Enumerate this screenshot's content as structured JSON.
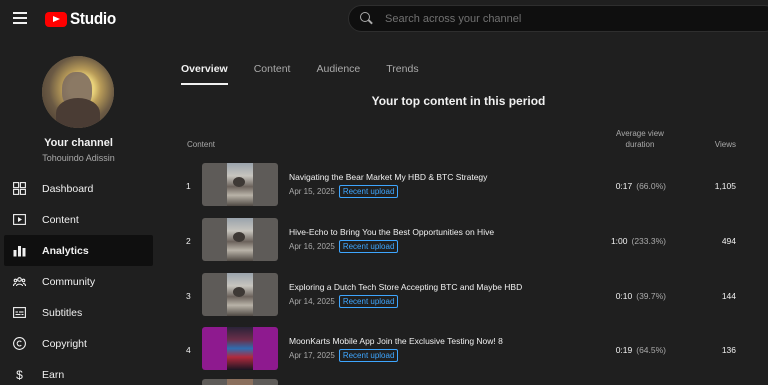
{
  "app": {
    "logo_text": "Studio"
  },
  "search": {
    "placeholder": "Search across your channel",
    "value": ""
  },
  "channel": {
    "title": "Your channel",
    "handle": "Tohouindo Adissin"
  },
  "sidebar": {
    "items": [
      {
        "label": "Dashboard",
        "icon": "dashboard-icon",
        "active": false
      },
      {
        "label": "Content",
        "icon": "content-icon",
        "active": false
      },
      {
        "label": "Analytics",
        "icon": "analytics-icon",
        "active": true
      },
      {
        "label": "Community",
        "icon": "community-icon",
        "active": false
      },
      {
        "label": "Subtitles",
        "icon": "subtitles-icon",
        "active": false
      },
      {
        "label": "Copyright",
        "icon": "copyright-icon",
        "active": false
      },
      {
        "label": "Earn",
        "icon": "earn-icon",
        "active": false
      }
    ]
  },
  "tabs": [
    {
      "label": "Overview",
      "active": true
    },
    {
      "label": "Content",
      "active": false
    },
    {
      "label": "Audience",
      "active": false
    },
    {
      "label": "Trends",
      "active": false
    }
  ],
  "section": {
    "title": "Your top content in this period"
  },
  "table": {
    "headers": {
      "content": "Content",
      "avg_line1": "Average view",
      "avg_line2": "duration",
      "views": "Views"
    },
    "rows": [
      {
        "rank": "1",
        "title": "Navigating the Bear Market My HBD & BTC Strategy",
        "date": "Apr 15, 2025",
        "badge": "Recent upload",
        "avg": "0:17",
        "pct": "(66.0%)",
        "views": "1,105",
        "thumb": "person"
      },
      {
        "rank": "2",
        "title": "Hive-Echo to Bring You the Best Opportunities on Hive",
        "date": "Apr 16, 2025",
        "badge": "Recent upload",
        "avg": "1:00",
        "pct": "(233.3%)",
        "views": "494",
        "thumb": "person"
      },
      {
        "rank": "3",
        "title": "Exploring a Dutch Tech Store Accepting BTC and Maybe HBD",
        "date": "Apr 14, 2025",
        "badge": "Recent upload",
        "avg": "0:10",
        "pct": "(39.7%)",
        "views": "144",
        "thumb": "person"
      },
      {
        "rank": "4",
        "title": "MoonKarts Mobile App Join the Exclusive Testing Now! 8",
        "date": "Apr 17, 2025",
        "badge": "Recent upload",
        "avg": "0:19",
        "pct": "(64.5%)",
        "views": "136",
        "thumb": "purple"
      }
    ]
  },
  "colors": {
    "background": "#1f1f1f",
    "search_bg": "#0f0f0f",
    "brand_red": "#ff0000",
    "badge_blue": "#3ea6ff",
    "muted_text": "#aaaaaa"
  }
}
